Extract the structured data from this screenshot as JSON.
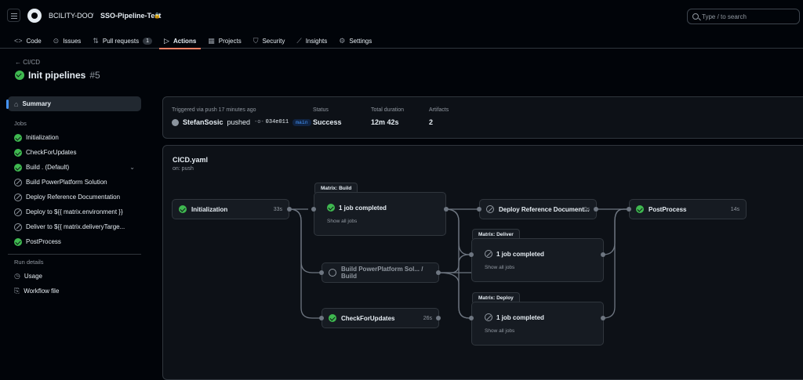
{
  "header": {
    "owner": "BCILITY-DOO",
    "separator": "/",
    "repo": "SSO-Pipeline-Test",
    "lock": "🔒",
    "search_placeholder": "Type / to search"
  },
  "tabs": [
    {
      "icon": "<>",
      "label": "Code"
    },
    {
      "icon": "⊙",
      "label": "Issues"
    },
    {
      "icon": "⇅",
      "label": "Pull requests",
      "count": "1"
    },
    {
      "icon": "▷",
      "label": "Actions"
    },
    {
      "icon": "▦",
      "label": "Projects"
    },
    {
      "icon": "⛉",
      "label": "Security"
    },
    {
      "icon": "⟋",
      "label": "Insights"
    },
    {
      "icon": "⚙",
      "label": "Settings"
    }
  ],
  "run": {
    "back_arrow": "←",
    "back": "CI/CD",
    "title": "Init pipelines",
    "number": "#5"
  },
  "sidebar": {
    "summary": "Summary",
    "jobs_heading": "Jobs",
    "jobs": [
      {
        "label": "Initialization",
        "status": "success"
      },
      {
        "label": "CheckForUpdates",
        "status": "success"
      },
      {
        "label": "Build . (Default)",
        "status": "success"
      },
      {
        "label": "Build PowerPlatform Solution",
        "status": "skipped"
      },
      {
        "label": "Deploy Reference Documentation",
        "status": "skipped"
      },
      {
        "label": "Deploy to ${{ matrix.environment }}",
        "status": "skipped"
      },
      {
        "label": "Deliver to ${{ matrix.deliveryTarge...",
        "status": "skipped"
      },
      {
        "label": "PostProcess",
        "status": "success"
      }
    ],
    "run_details_heading": "Run details",
    "usage": "Usage",
    "workflow_file": "Workflow file"
  },
  "summary": {
    "triggered_label": "Triggered via push 17 minutes ago",
    "actor": "StefanSosic",
    "action": "pushed",
    "commit_prefix": "-o-",
    "commit": "034e011",
    "branch": "main",
    "status_label": "Status",
    "status_value": "Success",
    "duration_label": "Total duration",
    "duration_value": "12m 42s",
    "artifacts_label": "Artifacts",
    "artifacts_value": "2"
  },
  "workflow": {
    "name": "CICD.yaml",
    "trigger": "on: push",
    "initialization": {
      "label": "Initialization",
      "duration": "33s"
    },
    "matrix_build": {
      "tab": "Matrix: Build",
      "label": "1 job completed",
      "show_all": "Show all jobs"
    },
    "build_pp": {
      "label": "Build PowerPlatform Sol... / Build"
    },
    "check_updates": {
      "label": "CheckForUpdates",
      "duration": "26s"
    },
    "deploy_ref": {
      "label": "Deploy Reference Document...",
      "duration": "0s"
    },
    "matrix_deliver": {
      "tab": "Matrix: Deliver",
      "label": "1 job completed",
      "show_all": "Show all jobs"
    },
    "matrix_deploy": {
      "tab": "Matrix: Deploy",
      "label": "1 job completed",
      "show_all": "Show all jobs"
    },
    "postprocess": {
      "label": "PostProcess",
      "duration": "14s"
    }
  }
}
